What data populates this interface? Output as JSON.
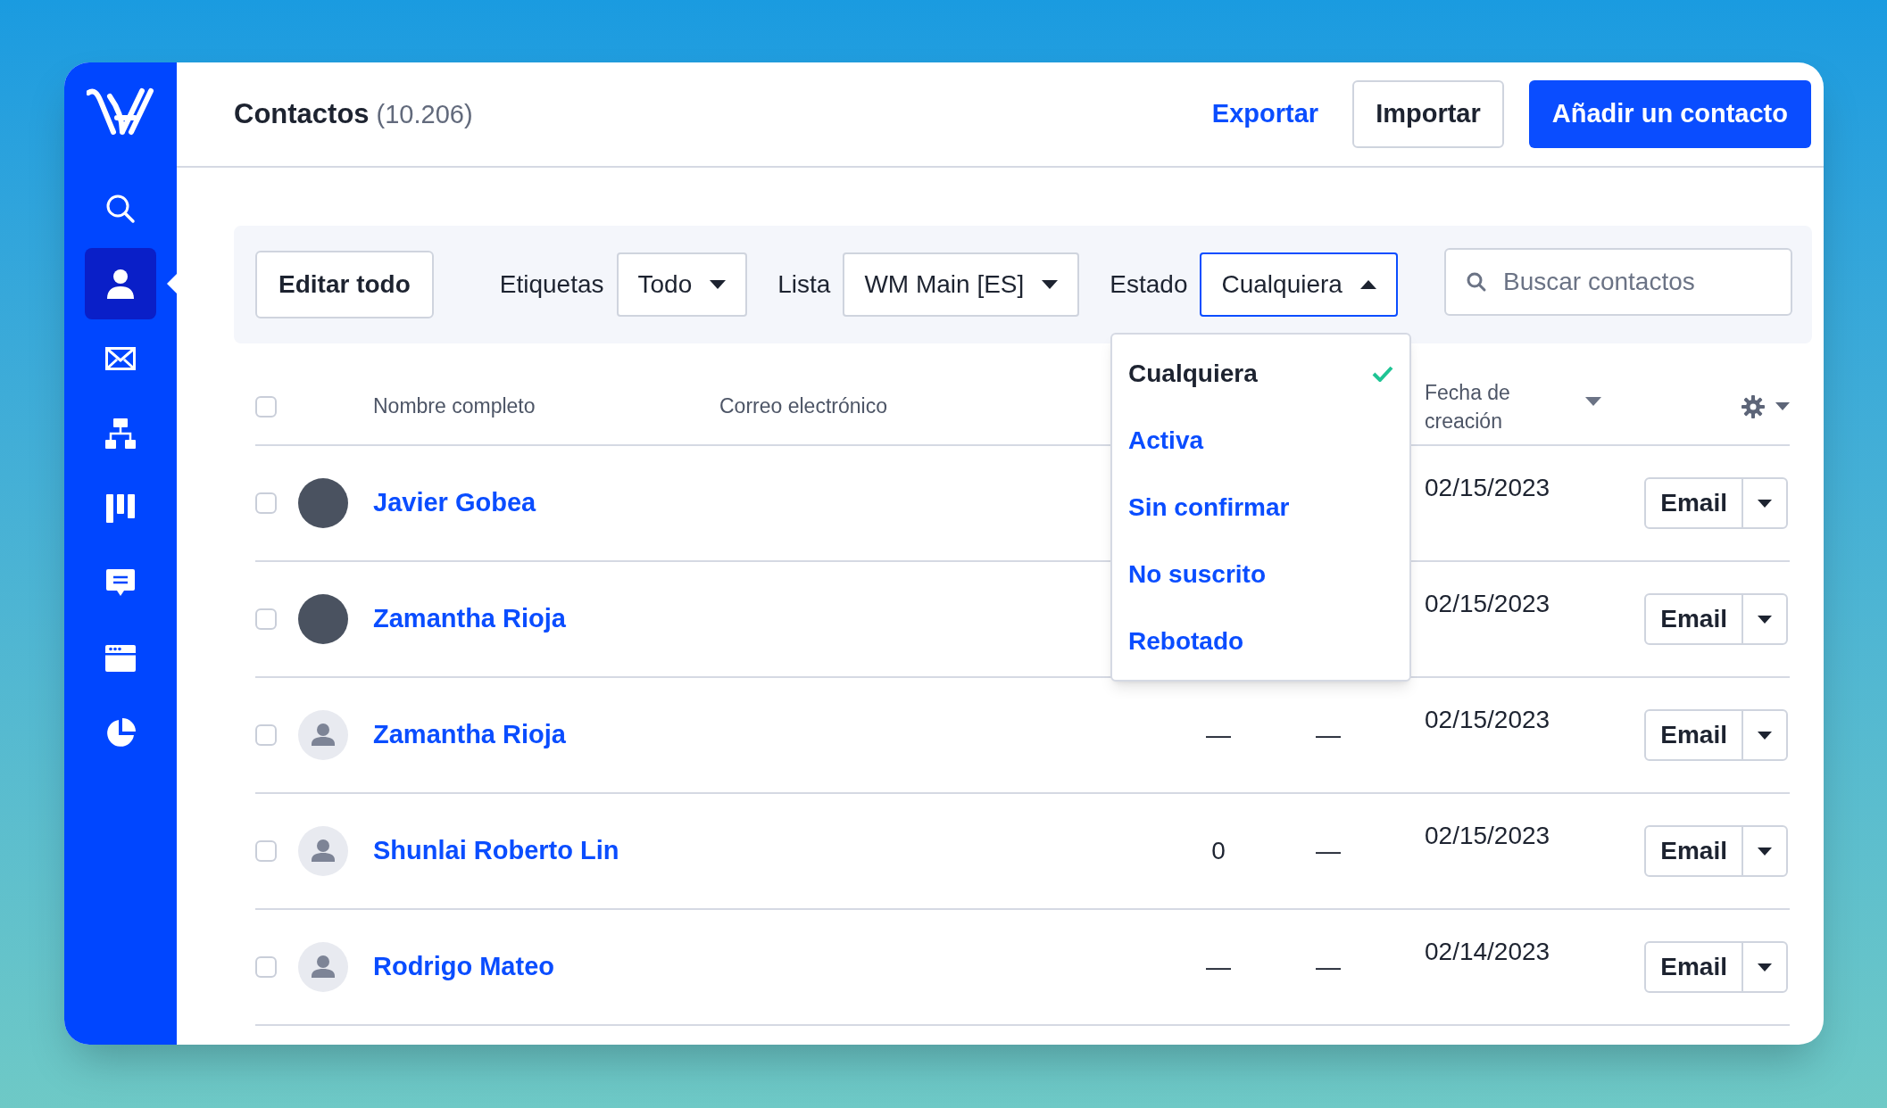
{
  "sidebar": {
    "items": [
      {
        "kind": "search",
        "selected": false
      },
      {
        "kind": "person",
        "selected": true
      },
      {
        "kind": "mail",
        "selected": false
      },
      {
        "kind": "sitemap",
        "selected": false
      },
      {
        "kind": "board",
        "selected": false
      },
      {
        "kind": "chat",
        "selected": false
      },
      {
        "kind": "window",
        "selected": false
      },
      {
        "kind": "pie",
        "selected": false
      }
    ]
  },
  "header": {
    "title": "Contactos",
    "count": "(10.206)",
    "export": "Exportar",
    "import": "Importar",
    "add": "Añadir un contacto"
  },
  "filters": {
    "edit_all": "Editar todo",
    "tags": {
      "label": "Etiquetas",
      "value": "Todo",
      "expanded": false
    },
    "list": {
      "label": "Lista",
      "value": "WM Main [ES]",
      "expanded": false
    },
    "status": {
      "label": "Estado",
      "value": "Cualquiera",
      "expanded": true
    },
    "search": {
      "placeholder": "Buscar contactos"
    }
  },
  "status_menu": {
    "options": [
      {
        "label": "Cualquiera",
        "selected": true
      },
      {
        "label": "Activa",
        "selected": false
      },
      {
        "label": "Sin confirmar",
        "selected": false
      },
      {
        "label": "No suscrito",
        "selected": false
      },
      {
        "label": "Rebotado",
        "selected": false
      }
    ]
  },
  "table": {
    "select_all_checked": false,
    "columns": {
      "name": "Nombre completo",
      "email": "Correo electrónico",
      "created": "Fecha de creación"
    },
    "rows": [
      {
        "checked": false,
        "kind": "photo",
        "name": "Javier Gobea",
        "created": "02/15/2023",
        "action": "Email"
      },
      {
        "checked": false,
        "kind": "photo",
        "name": "Zamantha Rioja",
        "created": "02/15/2023",
        "action": "Email"
      },
      {
        "checked": false,
        "kind": "placeholder",
        "name": "Zamantha Rioja",
        "column_3": "—",
        "column_4": "—",
        "created": "02/15/2023",
        "action": "Email"
      },
      {
        "checked": false,
        "kind": "placeholder",
        "name": "Shunlai Roberto Lin",
        "column_3": "0",
        "column_4": "—",
        "created": "02/15/2023",
        "action": "Email"
      },
      {
        "checked": false,
        "kind": "placeholder",
        "name": "Rodrigo Mateo",
        "column_3": "—",
        "column_4": "—",
        "created": "02/14/2023",
        "action": "Email"
      }
    ]
  }
}
